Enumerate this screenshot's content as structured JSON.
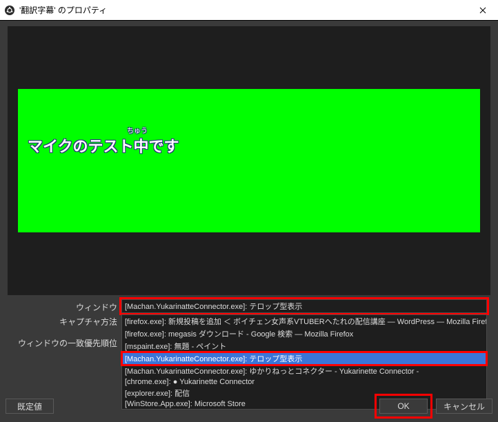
{
  "titlebar": {
    "title": "'翻訳字幕' のプロパティ"
  },
  "preview": {
    "text": "マイクのテスト中です",
    "ruby": "ちゅう"
  },
  "labels": {
    "window": "ウィンドウ",
    "capture_method": "キャプチャ方法",
    "match_priority": "ウィンドウの一致優先順位"
  },
  "select_window_value": "[Machan.YukarinatteConnector.exe]: テロップ型表示",
  "dropdown": {
    "opts": [
      "[firefox.exe]: 新規投稿を追加 ＜ ボイチェン女声系VTUBERへたれの配信講座 — WordPress — Mozilla Firefox",
      "[firefox.exe]: megasis ダウンロード - Google 検索 — Mozilla Firefox",
      "[mspaint.exe]: 無題 - ペイント",
      "[Machan.YukarinatteConnector.exe]: テロップ型表示",
      "[Machan.YukarinatteConnector.exe]: ゆかりねっとコネクター - Yukarinette Connector -",
      "[chrome.exe]: ● Yukarinette Connector",
      "[explorer.exe]: 配信",
      "[WinStore.App.exe]: Microsoft Store"
    ],
    "selected_index": 3
  },
  "buttons": {
    "defaults": "既定値",
    "ok": "OK",
    "cancel": "キャンセル"
  }
}
